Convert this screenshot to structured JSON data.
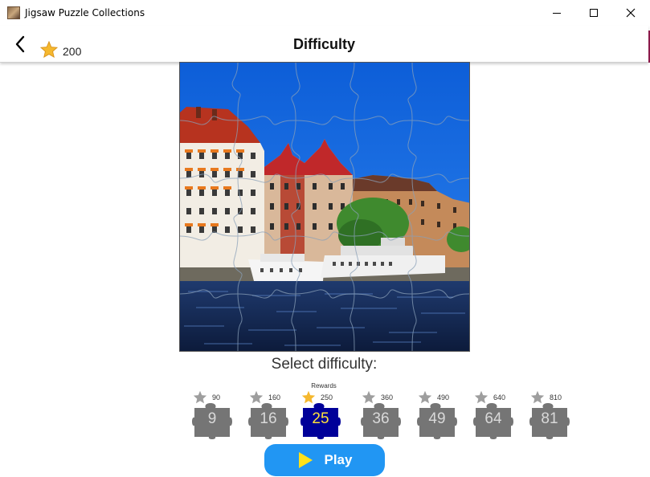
{
  "window": {
    "title": "Jigsaw Puzzle Collections",
    "controls": [
      "minimize",
      "maximize",
      "close"
    ]
  },
  "header": {
    "back_icon": "chevron-left-icon",
    "coins": "200",
    "title": "Difficulty"
  },
  "main": {
    "select_label": "Select difficulty:",
    "rewards_label": "Rewards",
    "difficulties": [
      {
        "pieces": "9",
        "reward": "90",
        "selected": false
      },
      {
        "pieces": "16",
        "reward": "160",
        "selected": false
      },
      {
        "pieces": "25",
        "reward": "250",
        "selected": true
      },
      {
        "pieces": "36",
        "reward": "360",
        "selected": false
      },
      {
        "pieces": "49",
        "reward": "490",
        "selected": false
      },
      {
        "pieces": "64",
        "reward": "640",
        "selected": false
      },
      {
        "pieces": "81",
        "reward": "810",
        "selected": false
      }
    ],
    "play_label": "Play"
  },
  "colors": {
    "accent": "#2196f3",
    "selected_piece": "#000099",
    "piece": "#757575",
    "star_gold": "#f5b82e",
    "star_grey": "#9e9e9e",
    "selected_text": "#ffe23a"
  }
}
